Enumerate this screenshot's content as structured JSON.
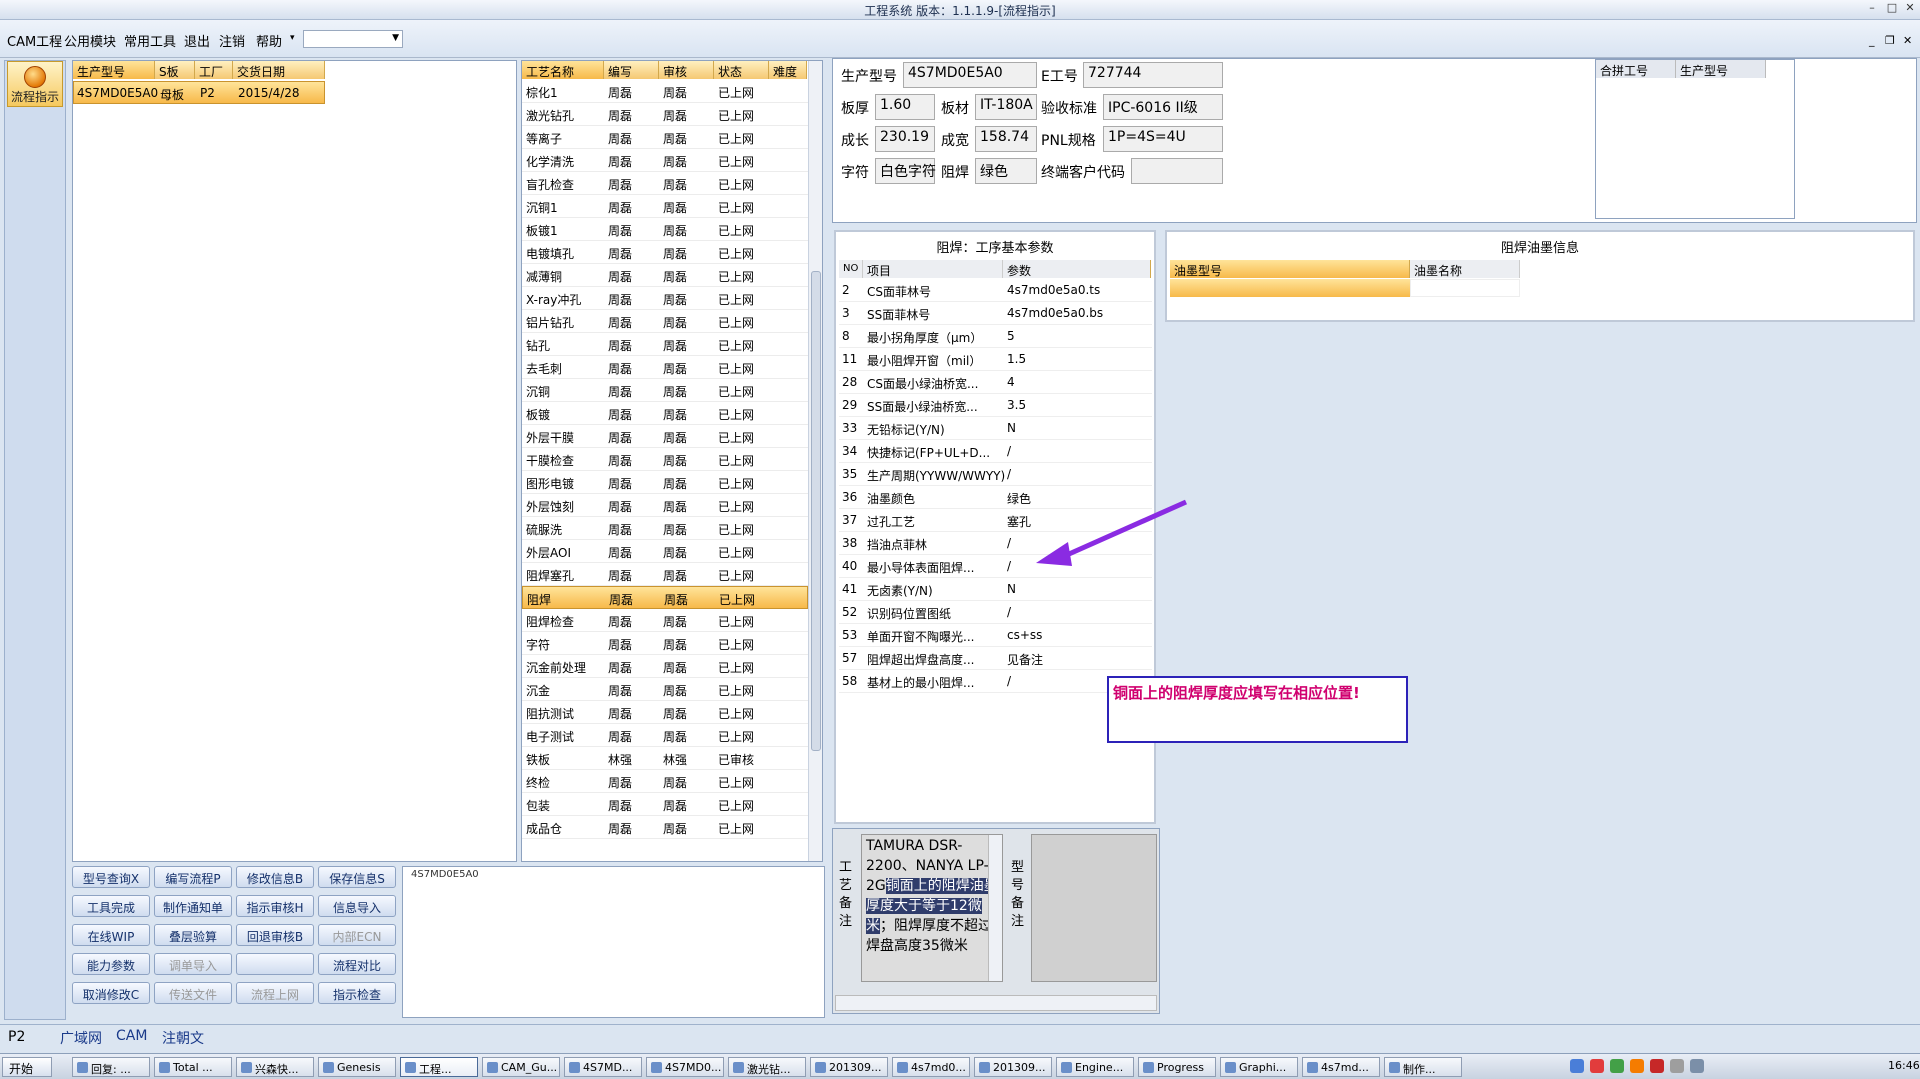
{
  "window": {
    "title": "工程系统 版本：1.1.1.9-[流程指示]",
    "min": "–",
    "max": "□",
    "close": "✕"
  },
  "menu": {
    "items": [
      "CAM工程",
      "公用模块",
      "常用工具",
      "退出",
      "注销",
      "帮助"
    ],
    "help_arrow": "▾"
  },
  "mdi": {
    "min": "_",
    "restore": "❐",
    "close": "✕"
  },
  "nav": {
    "label": "流程指示"
  },
  "orders": {
    "headers": [
      "生产型号",
      "S板",
      "工厂",
      "交货日期"
    ],
    "rows": [
      [
        "4S7MD0E5A0",
        "母板",
        "P2",
        "2015/4/28"
      ]
    ]
  },
  "process": {
    "headers": [
      "工艺名称",
      "编写",
      "审核",
      "状态",
      "难度"
    ],
    "selected_index": 23,
    "rows": [
      [
        "棕化1",
        "周磊",
        "周磊",
        "已上网"
      ],
      [
        "激光钻孔",
        "周磊",
        "周磊",
        "已上网"
      ],
      [
        "等离子",
        "周磊",
        "周磊",
        "已上网"
      ],
      [
        "化学清洗",
        "周磊",
        "周磊",
        "已上网"
      ],
      [
        "盲孔检查",
        "周磊",
        "周磊",
        "已上网"
      ],
      [
        "沉铜1",
        "周磊",
        "周磊",
        "已上网"
      ],
      [
        "板镀1",
        "周磊",
        "周磊",
        "已上网"
      ],
      [
        "电镀填孔",
        "周磊",
        "周磊",
        "已上网"
      ],
      [
        "减薄铜",
        "周磊",
        "周磊",
        "已上网"
      ],
      [
        "X-ray冲孔",
        "周磊",
        "周磊",
        "已上网"
      ],
      [
        "铝片钻孔",
        "周磊",
        "周磊",
        "已上网"
      ],
      [
        "钻孔",
        "周磊",
        "周磊",
        "已上网"
      ],
      [
        "去毛刺",
        "周磊",
        "周磊",
        "已上网"
      ],
      [
        "沉铜",
        "周磊",
        "周磊",
        "已上网"
      ],
      [
        "板镀",
        "周磊",
        "周磊",
        "已上网"
      ],
      [
        "外层干膜",
        "周磊",
        "周磊",
        "已上网"
      ],
      [
        "干膜检查",
        "周磊",
        "周磊",
        "已上网"
      ],
      [
        "图形电镀",
        "周磊",
        "周磊",
        "已上网"
      ],
      [
        "外层蚀刻",
        "周磊",
        "周磊",
        "已上网"
      ],
      [
        "硫脲洗",
        "周磊",
        "周磊",
        "已上网"
      ],
      [
        "外层AOI",
        "周磊",
        "周磊",
        "已上网"
      ],
      [
        "阻焊塞孔",
        "周磊",
        "周磊",
        "已上网"
      ],
      [
        "阻焊",
        "周磊",
        "周磊",
        "已上网"
      ],
      [
        "阻焊检查",
        "周磊",
        "周磊",
        "已上网"
      ],
      [
        "字符",
        "周磊",
        "周磊",
        "已上网"
      ],
      [
        "沉金前处理",
        "周磊",
        "周磊",
        "已上网"
      ],
      [
        "沉金",
        "周磊",
        "周磊",
        "已上网"
      ],
      [
        "阻抗测试",
        "周磊",
        "周磊",
        "已上网"
      ],
      [
        "电子测试",
        "周磊",
        "周磊",
        "已上网"
      ],
      [
        "铁板",
        "林强",
        "林强",
        "已审核"
      ],
      [
        "终检",
        "周磊",
        "周磊",
        "已上网"
      ],
      [
        "包装",
        "周磊",
        "周磊",
        "已上网"
      ],
      [
        "成品仓",
        "周磊",
        "周磊",
        "已上网"
      ]
    ]
  },
  "buttons": [
    [
      "型号查询X",
      "编写流程P",
      "修改信息B",
      "保存信息S"
    ],
    [
      "工具完成",
      "制作通知单",
      "指示审核H",
      "信息导入"
    ],
    [
      "在线WIP",
      "叠层验算",
      "回退审核B",
      "内部ECN"
    ],
    [
      "能力参数",
      "调单导入",
      "",
      "流程对比"
    ],
    [
      "取消修改C",
      "传送文件",
      "流程上网",
      "指示检查"
    ]
  ],
  "disabled_buttons": [
    "内部ECN",
    "调单导入",
    "传送文件",
    "流程上网"
  ],
  "tree": {
    "node": "4S7MD0E5A0"
  },
  "info": {
    "model_label": "生产型号",
    "model": "4S7MD0E5A0",
    "e_label": "E工号",
    "e": "727744",
    "thick_label": "板厚",
    "thick": "1.60",
    "mat_label": "板材",
    "mat": "IT-180A",
    "std_label": "验收标准",
    "std": "IPC-6016 II级",
    "len_label": "成长",
    "len": "230.19",
    "wid_label": "成宽",
    "wid": "158.74",
    "pnl_label": "PNL规格",
    "pnl": "1P=4S=4U",
    "char_label": "字符",
    "char": "白色字符",
    "mask_label": "阻焊",
    "mask": "绿色",
    "cust_label": "终端客户代码",
    "cust": ""
  },
  "merge": {
    "headers": [
      "合拼工号",
      "生产型号"
    ]
  },
  "params": {
    "title": "阻焊：工序基本参数",
    "headers": [
      "NO",
      "项目",
      "参数"
    ],
    "rows": [
      [
        "2",
        "CS面菲林号",
        "4s7md0e5a0.ts"
      ],
      [
        "3",
        "SS面菲林号",
        "4s7md0e5a0.bs"
      ],
      [
        "8",
        "最小拐角厚度（μm）",
        "5"
      ],
      [
        "11",
        "最小阻焊开窗（mil）",
        "1.5"
      ],
      [
        "28",
        "CS面最小绿油桥宽...",
        "4"
      ],
      [
        "29",
        "SS面最小绿油桥宽...",
        "3.5"
      ],
      [
        "33",
        "无铅标记(Y/N)",
        "N"
      ],
      [
        "34",
        "快捷标记(FP+UL+D...",
        "/"
      ],
      [
        "35",
        "生产周期(YYWW/WWYY)",
        "/"
      ],
      [
        "36",
        "油墨颜色",
        "绿色"
      ],
      [
        "37",
        "过孔工艺",
        "塞孔"
      ],
      [
        "38",
        "挡油点菲林",
        "/"
      ],
      [
        "40",
        "最小导体表面阻焊...",
        "/"
      ],
      [
        "41",
        "无卤素(Y/N)",
        "N"
      ],
      [
        "52",
        "识别码位置图纸",
        "/"
      ],
      [
        "53",
        "单面开窗不陶曝光...",
        "cs+ss"
      ],
      [
        "57",
        "阻焊超出焊盘高度...",
        "见备注"
      ],
      [
        "58",
        "基材上的最小阻焊...",
        "/"
      ]
    ]
  },
  "ink": {
    "title": "阻焊油墨信息",
    "headers": [
      "油墨型号",
      "油墨名称"
    ]
  },
  "callout": {
    "text": "铜面上的阻焊厚度应填写在相应位置!",
    "color": "#d0006f",
    "arrow_color": "#8a2be2"
  },
  "remarks": {
    "label": "工艺备注",
    "before": "TAMURA DSR-2200、NANYA LP-2G",
    "highlight": "铜面上的阻焊油墨厚度大于等于12微米",
    "after": "；阻焊厚度不超过焊盘高度35微米",
    "model_label": "型号备注"
  },
  "status": {
    "factory": "P2",
    "tabs": [
      "广域网",
      "CAM",
      "注朝文"
    ]
  },
  "taskbar": {
    "start": "开始",
    "items": [
      "回复: ...",
      "Total ...",
      "兴森快...",
      "Genesis",
      "工程...",
      "CAM_Gu...",
      "4S7MD...",
      "4S7MD0...",
      "激光钻...",
      "201309...",
      "4s7md0...",
      "201309...",
      "Engine...",
      "Progress",
      "Graphi...",
      "4s7md...",
      "制作..."
    ],
    "clock": "16:46"
  }
}
